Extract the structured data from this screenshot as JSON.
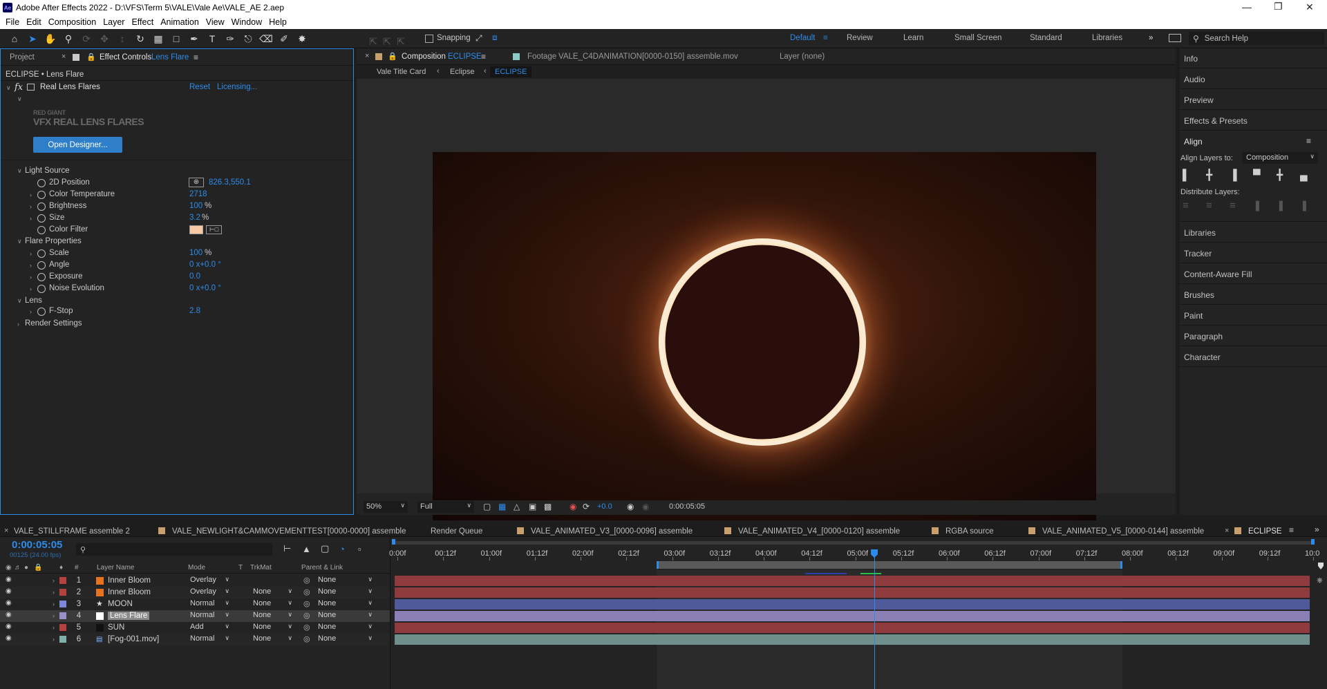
{
  "app": {
    "title": "Adobe After Effects 2022 - D:\\VFS\\Term 5\\VALE\\Vale Ae\\VALE_AE 2.aep",
    "logo": "Ae",
    "menu": [
      "File",
      "Edit",
      "Composition",
      "Layer",
      "Effect",
      "Animation",
      "View",
      "Window",
      "Help"
    ]
  },
  "toolbar": {
    "snapping": "Snapping",
    "workspaces": [
      "Default",
      "Review",
      "Learn",
      "Small Screen",
      "Standard",
      "Libraries"
    ],
    "search_placeholder": "Search Help"
  },
  "effect_panel": {
    "tab_project": "Project",
    "tab_effect": "Effect Controls",
    "tab_effect_layer": "Lens Flare",
    "breadcrumb": "ECLIPSE • Lens Flare",
    "fx_name": "Real Lens Flares",
    "reset": "Reset",
    "licensing": "Licensing...",
    "brand_small": "RED GIANT",
    "brand_big": "VFX REAL LENS FLARES",
    "open_designer": "Open Designer...",
    "groups": {
      "light_source": "Light Source",
      "flare_properties": "Flare Properties",
      "lens": "Lens",
      "render_settings": "Render Settings"
    },
    "props": {
      "position_label": "2D Position",
      "position_value": "826.3,550.1",
      "color_temp_label": "Color Temperature",
      "color_temp_value": "2718",
      "brightness_label": "Brightness",
      "brightness_value": "100",
      "size_label": "Size",
      "size_value": "3.2",
      "color_filter_label": "Color Filter",
      "scale_label": "Scale",
      "scale_value": "100",
      "angle_label": "Angle",
      "angle_value": "0 x+0.0 °",
      "exposure_label": "Exposure",
      "exposure_value": "0.0",
      "noise_label": "Noise Evolution",
      "noise_value": "0 x+0.0 °",
      "fstop_label": "F-Stop",
      "fstop_value": "2.8",
      "percent": "%"
    },
    "color_filter_swatch": "#f7c9a3"
  },
  "comp_panel": {
    "tab_comp": "Composition",
    "tab_comp_name": "ECLIPSE",
    "tab_footage": "Footage",
    "tab_footage_name": "VALE_C4DANIMATION[0000-0150] assemble.mov",
    "tab_layer": "Layer (none)",
    "crumbs": [
      "Vale Title Card",
      "Eclipse",
      "ECLIPSE"
    ],
    "zoom": "50%",
    "resolution": "Full",
    "exposure": "+0.0",
    "timecode": "0:00:05:05"
  },
  "right_panel": {
    "items_top": [
      "Info",
      "Audio",
      "Preview",
      "Effects & Presets"
    ],
    "align_title": "Align",
    "align_to_label": "Align Layers to:",
    "align_to_value": "Composition",
    "distribute_label": "Distribute Layers:",
    "items_bottom": [
      "Libraries",
      "Tracker",
      "Content-Aware Fill",
      "Brushes",
      "Paint",
      "Paragraph",
      "Character"
    ]
  },
  "timeline": {
    "tabs": [
      {
        "label": "VALE_STILLFRAME assemble 2",
        "color": "#c8a06e"
      },
      {
        "label": "VALE_NEWLIGHT&CAMMOVEMENTTEST[0000-0000] assemble",
        "color": "#c8a06e"
      },
      {
        "label": "Render Queue",
        "color": ""
      },
      {
        "label": "VALE_ANIMATED_V3_[0000-0096] assemble",
        "color": "#c8a06e"
      },
      {
        "label": "VALE_ANIMATED_V4_[0000-0120] assemble",
        "color": "#c8a06e"
      },
      {
        "label": "RGBA source",
        "color": "#c8a06e"
      },
      {
        "label": "VALE_ANIMATED_V5_[0000-0144] assemble",
        "color": "#c8a06e"
      },
      {
        "label": "ECLIPSE",
        "color": "#c8a06e"
      }
    ],
    "current_time": "0:00:05:05",
    "frame_info": "00125 (24.00 fps)",
    "search_placeholder": "",
    "col_headers": {
      "layer_name": "Layer Name",
      "mode": "Mode",
      "t": "T",
      "trkmat": "TrkMat",
      "parent": "Parent & Link"
    },
    "ruler": [
      "0:00f",
      "00:12f",
      "01:00f",
      "01:12f",
      "02:00f",
      "02:12f",
      "03:00f",
      "03:12f",
      "04:00f",
      "04:12f",
      "05:00f",
      "05:12f",
      "06:00f",
      "06:12f",
      "07:00f",
      "07:12f",
      "08:00f",
      "08:12f",
      "09:00f",
      "09:12f",
      "10:0"
    ],
    "layers": [
      {
        "num": "1",
        "name": "Inner Bloom",
        "mode": "Overlay",
        "trkmat": "",
        "parent": "None",
        "label": "#b3413e",
        "color": "#e8731f",
        "bar": "#8f3a3d"
      },
      {
        "num": "2",
        "name": "Inner Bloom",
        "mode": "Overlay",
        "trkmat": "None",
        "parent": "None",
        "label": "#b3413e",
        "color": "#e8731f",
        "bar": "#8f3a3d"
      },
      {
        "num": "3",
        "name": "MOON",
        "mode": "Normal",
        "trkmat": "None",
        "parent": "None",
        "label": "#7d86d8",
        "color": "",
        "bar": "#4f5a9a"
      },
      {
        "num": "4",
        "name": "Lens Flare",
        "mode": "Normal",
        "trkmat": "None",
        "parent": "None",
        "label": "#9a8fc9",
        "color": "#ffffff",
        "bar": "#8a80b6"
      },
      {
        "num": "5",
        "name": "SUN",
        "mode": "Add",
        "trkmat": "None",
        "parent": "None",
        "label": "#b3413e",
        "color": "#111111",
        "bar": "#8f3a3d"
      },
      {
        "num": "6",
        "name": "[Fog-001.mov]",
        "mode": "Normal",
        "trkmat": "None",
        "parent": "None",
        "label": "#7fb0aa",
        "color": "",
        "bar": "#6e8f8b"
      }
    ],
    "playhead_fraction": 0.5208,
    "work_area_start_fraction": 0.2833,
    "work_area_end_fraction": 0.7917
  }
}
